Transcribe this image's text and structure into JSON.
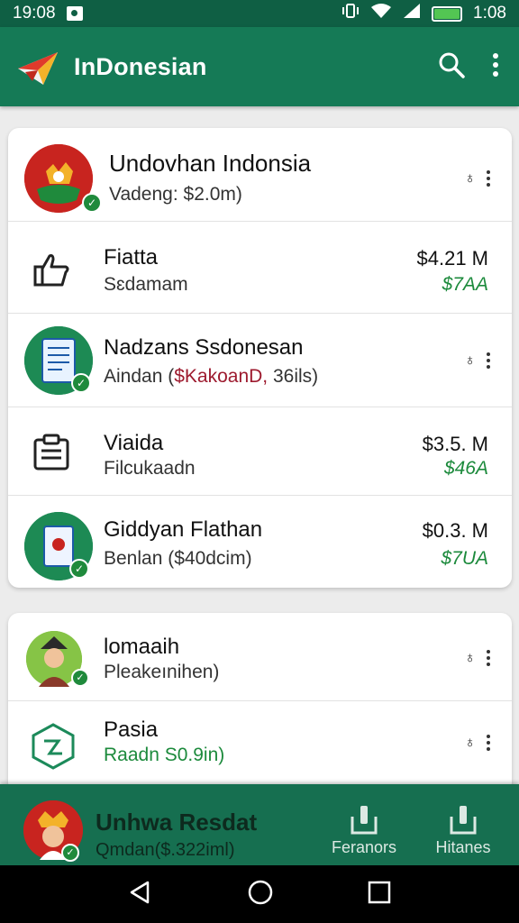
{
  "status_bar": {
    "time_left": "19:08",
    "time_right": "1:08"
  },
  "app_bar": {
    "title": "InDonesian",
    "search_icon": "search-icon",
    "menu_icon": "more-vert-icon"
  },
  "card1": {
    "rows": [
      {
        "title": "Undovhan Indonsia",
        "subtitle": "Vadeng: $2.0m)",
        "action_glyph": "♁"
      },
      {
        "title": "Fiatta",
        "subtitle": "Sɛdamam",
        "amount": "$4.21 M",
        "amount_sub": "$7AA"
      },
      {
        "title": "Nadzans Ssdonesan",
        "subtitle_a": "Aindan (",
        "subtitle_b": "$KakoanD,",
        "subtitle_c": " 36ils)",
        "action_glyph": "♁"
      },
      {
        "title": "Viaida",
        "subtitle": "Filcukaadn",
        "amount": "$3.5. M",
        "amount_sub": "$46A"
      },
      {
        "title": "Giddyan Flathan",
        "subtitle": "Benlan ($40dcim)",
        "amount": "$0.3. M",
        "amount_sub": "$7UA"
      }
    ]
  },
  "card2": {
    "rows": [
      {
        "title": "lomaaih",
        "subtitle": "Pleakeınihen)",
        "action_glyph": "♁"
      },
      {
        "title": "Pasia",
        "subtitle": "Raadn S0.9in)",
        "action_glyph": "♁"
      }
    ]
  },
  "bottom_bar": {
    "title": "Unhwa Resdat",
    "subtitle": "Qmdan($.322iml)",
    "tabs": [
      {
        "label": "Feranors"
      },
      {
        "label": "Hitanes"
      }
    ]
  },
  "colors": {
    "primary": "#157a56",
    "status": "#0f5f44",
    "accent_green": "#1c8a3c",
    "accent_red": "#9d1a2e"
  }
}
